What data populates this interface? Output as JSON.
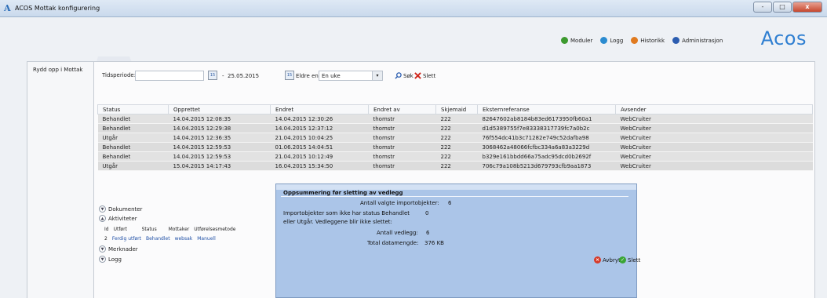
{
  "window": {
    "title": "ACOS Mottak konfigurering",
    "app_icon": "A",
    "minimize_icon": "-",
    "maximize_icon": "□",
    "close_icon": "x"
  },
  "topnav": [
    {
      "label": "Moduler",
      "icon": "modules-icon",
      "color": "#3d9a2f"
    },
    {
      "label": "Logg",
      "icon": "log-icon",
      "color": "#2a8bd0"
    },
    {
      "label": "Historikk",
      "icon": "history-icon",
      "color": "#e07a1f"
    },
    {
      "label": "Administrasjon",
      "icon": "admin-icon",
      "color": "#2c5db0"
    }
  ],
  "logo": "Acos",
  "sidetab": {
    "label": "Rydd opp i Mottak"
  },
  "filters": {
    "period_label": "Tidsperiode:",
    "from_value": "",
    "separator": "-",
    "to_value": "25.05.2015",
    "calendar_icon_text": "15",
    "older_label": "Eldre enn",
    "older_selected": "En uke",
    "dropdown_arrow": "▾",
    "search_label": "Søk",
    "delete_label": "Slett"
  },
  "table": {
    "columns": [
      "Status",
      "Opprettet",
      "Endret",
      "Endret av",
      "Skjemaid",
      "Eksternreferanse",
      "Avsender"
    ],
    "rows": [
      [
        "Behandlet",
        "14.04.2015 12:08:35",
        "14.04.2015 12:30:26",
        "thomstr",
        "222",
        "82647602ab8184b83ed6173950fb60a1",
        "WebCruiter"
      ],
      [
        "Behandlet",
        "14.04.2015 12:29:38",
        "14.04.2015 12:37:12",
        "thomstr",
        "222",
        "d1d5389755f7e83338317739fc7a0b2c",
        "WebCruiter"
      ],
      [
        "Utgår",
        "14.04.2015 12:36:35",
        "21.04.2015 10:04:25",
        "thomstr",
        "222",
        "76f554dc41b3c71282e749c52dafba98",
        "WebCruiter"
      ],
      [
        "Behandlet",
        "14.04.2015 12:59:53",
        "01.06.2015 14:04:51",
        "thomstr",
        "222",
        "3068462a48066fcfbc334a6a83a3229d",
        "WebCruiter"
      ],
      [
        "Behandlet",
        "14.04.2015 12:59:53",
        "21.04.2015 10:12:49",
        "thomstr",
        "222",
        "b329e161bbdd66a75adc95dcd0b2692f",
        "WebCruiter"
      ],
      [
        "Utgår",
        "15.04.2015 14:17:43",
        "16.04.2015 15:34:50",
        "thomstr",
        "222",
        "706c79a108b5213d679793cfb9aa1873",
        "WebCruiter"
      ]
    ]
  },
  "sections": {
    "dokumenter": "Dokumenter",
    "aktiviteter": "Aktiviteter",
    "merknader": "Merknader",
    "logg": "Logg",
    "activity_headers": [
      "Id",
      "Utført",
      "Status",
      "Mottaker",
      "Utførelsesmetode"
    ],
    "activity_row": [
      "2",
      "Ferdig utført",
      "Behandlet",
      "websak",
      "Manuell"
    ]
  },
  "dialog": {
    "title": "Oppsummering før sletting av vedlegg",
    "selected_label": "Antall valgte importobjekter:",
    "selected_value": "6",
    "not_status_line1": "Importobjekter som ikke har status Behandlet",
    "not_status_value": "0",
    "not_status_line2": "eller Utgår. Vedleggene blir ikke slettet:",
    "attachments_label": "Antall vedlegg:",
    "attachments_value": "6",
    "total_label": "Total datamengde:",
    "total_value": "376 KB",
    "cancel_label": "Avbryt",
    "delete_label": "Slett"
  }
}
